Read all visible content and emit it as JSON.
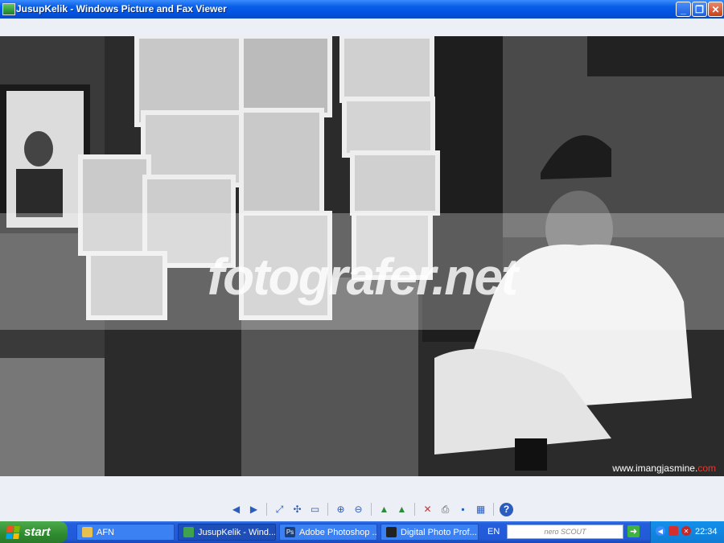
{
  "window": {
    "title": "JusupKelik - Windows Picture and Fax Viewer",
    "minimize": "_",
    "maximize": "❐",
    "close": "✕"
  },
  "photo": {
    "watermark": "fotografer.net",
    "credit_main": "www.imangjasmine.",
    "credit_tld": "com"
  },
  "toolbar": {
    "buttons": [
      {
        "name": "previous-image-button",
        "glyph": "◀"
      },
      {
        "name": "next-image-button",
        "glyph": "▶"
      },
      {
        "name": "best-fit-button",
        "glyph": "⤢"
      },
      {
        "name": "actual-size-button",
        "glyph": "✣"
      },
      {
        "name": "slideshow-button",
        "glyph": "▭"
      },
      {
        "name": "zoom-in-button",
        "glyph": "⊕"
      },
      {
        "name": "zoom-out-button",
        "glyph": "⊖"
      },
      {
        "name": "rotate-clockwise-button",
        "glyph": "▲"
      },
      {
        "name": "rotate-counterclockwise-button",
        "glyph": "▲"
      },
      {
        "name": "delete-button",
        "glyph": "✕"
      },
      {
        "name": "print-button",
        "glyph": "⎙"
      },
      {
        "name": "save-copy-button",
        "glyph": "▪"
      },
      {
        "name": "open-for-editing-button",
        "glyph": "▦"
      },
      {
        "name": "help-button",
        "glyph": "?"
      }
    ]
  },
  "taskbar": {
    "start_label": "start",
    "tasks": [
      {
        "label": "AFN",
        "icon": "folder-icon",
        "color": "#E8C050"
      },
      {
        "label": "JusupKelik - Wind...",
        "icon": "picture-viewer-icon",
        "color": "#3FA34D"
      },
      {
        "label": "Adobe Photoshop ...",
        "icon": "photoshop-icon",
        "color": "#1B3F7A"
      },
      {
        "label": "Digital Photo Prof...",
        "icon": "camera-icon",
        "color": "#222222"
      }
    ],
    "language": "EN",
    "search_placeholder": "nero SCOUT",
    "clock": "22:34"
  }
}
